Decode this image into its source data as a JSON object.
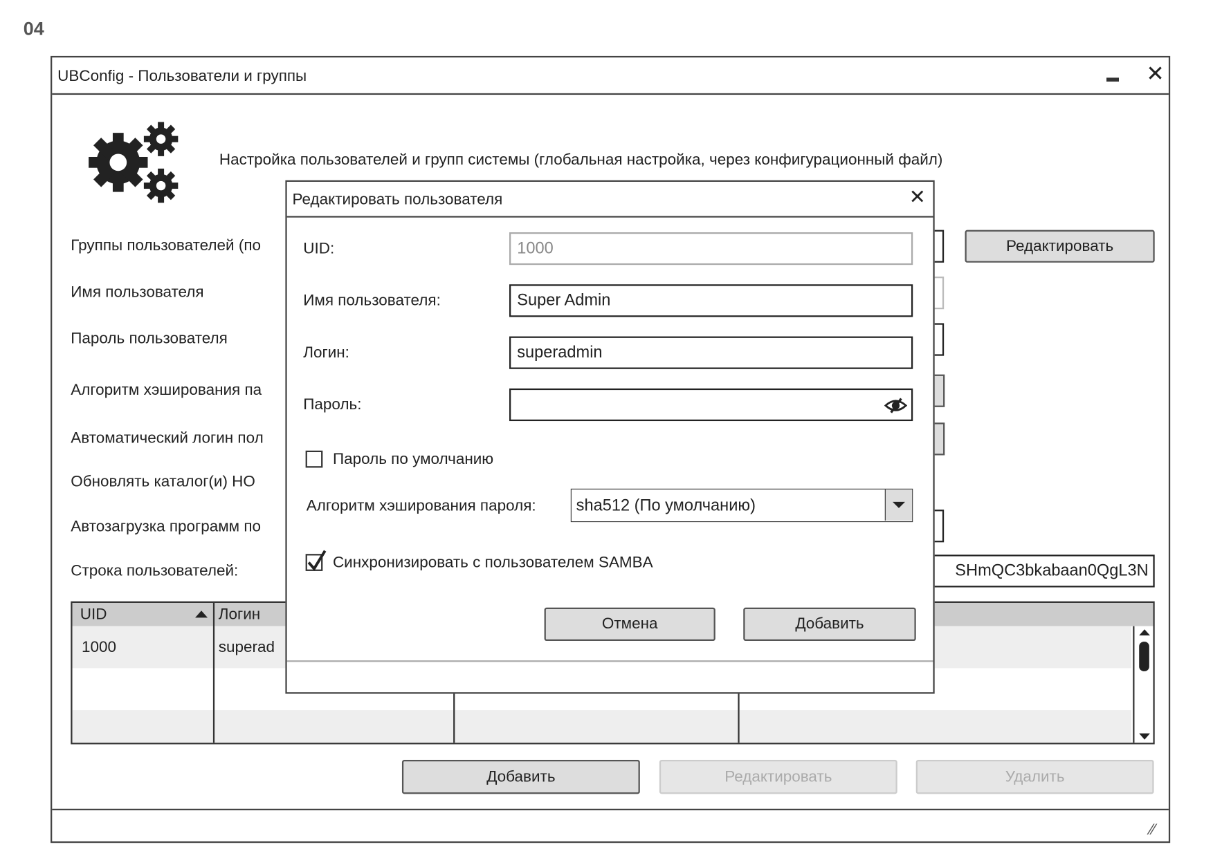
{
  "page_label": "04",
  "window": {
    "title": "UBConfig - Пользователи и группы",
    "header_text": "Настройка пользователей и групп системы (глобальная настройка, через конфигурационный файл)",
    "labels": [
      "Группы пользователей (по",
      "Имя пользователя",
      "Пароль пользователя",
      "Алгоритм хэширования па",
      "Автоматический логин пол",
      "Обновлять каталог(и) HO",
      "Автозагрузка программ по",
      "Строка пользователей:"
    ],
    "groups_edit_button": "Редактировать",
    "users_string_value": "SHmQC3bkabaan0QgL3N",
    "table": {
      "columns": [
        "UID",
        "Логин",
        "",
        ""
      ],
      "sort_column": "UID",
      "rows": [
        [
          "1000",
          "superad",
          "",
          ""
        ]
      ]
    },
    "buttons": {
      "add": "Добавить",
      "edit": "Редактировать",
      "delete": "Удалить"
    }
  },
  "dialog": {
    "title": "Редактировать пользователя",
    "uid_label": "UID:",
    "uid_value": "1000",
    "name_label": "Имя пользователя:",
    "name_value": "Super Admin",
    "login_label": "Логин:",
    "login_value": "superadmin",
    "password_label": "Пароль:",
    "password_value": "",
    "default_password_label": "Пароль по умолчанию",
    "default_password_checked": false,
    "hash_label": "Алгоритм хэширования пароля:",
    "hash_value": "sha512 (По умолчанию)",
    "samba_label": "Синхронизировать с пользователем SAMBA",
    "samba_checked": true,
    "cancel": "Отмена",
    "add": "Добавить"
  }
}
